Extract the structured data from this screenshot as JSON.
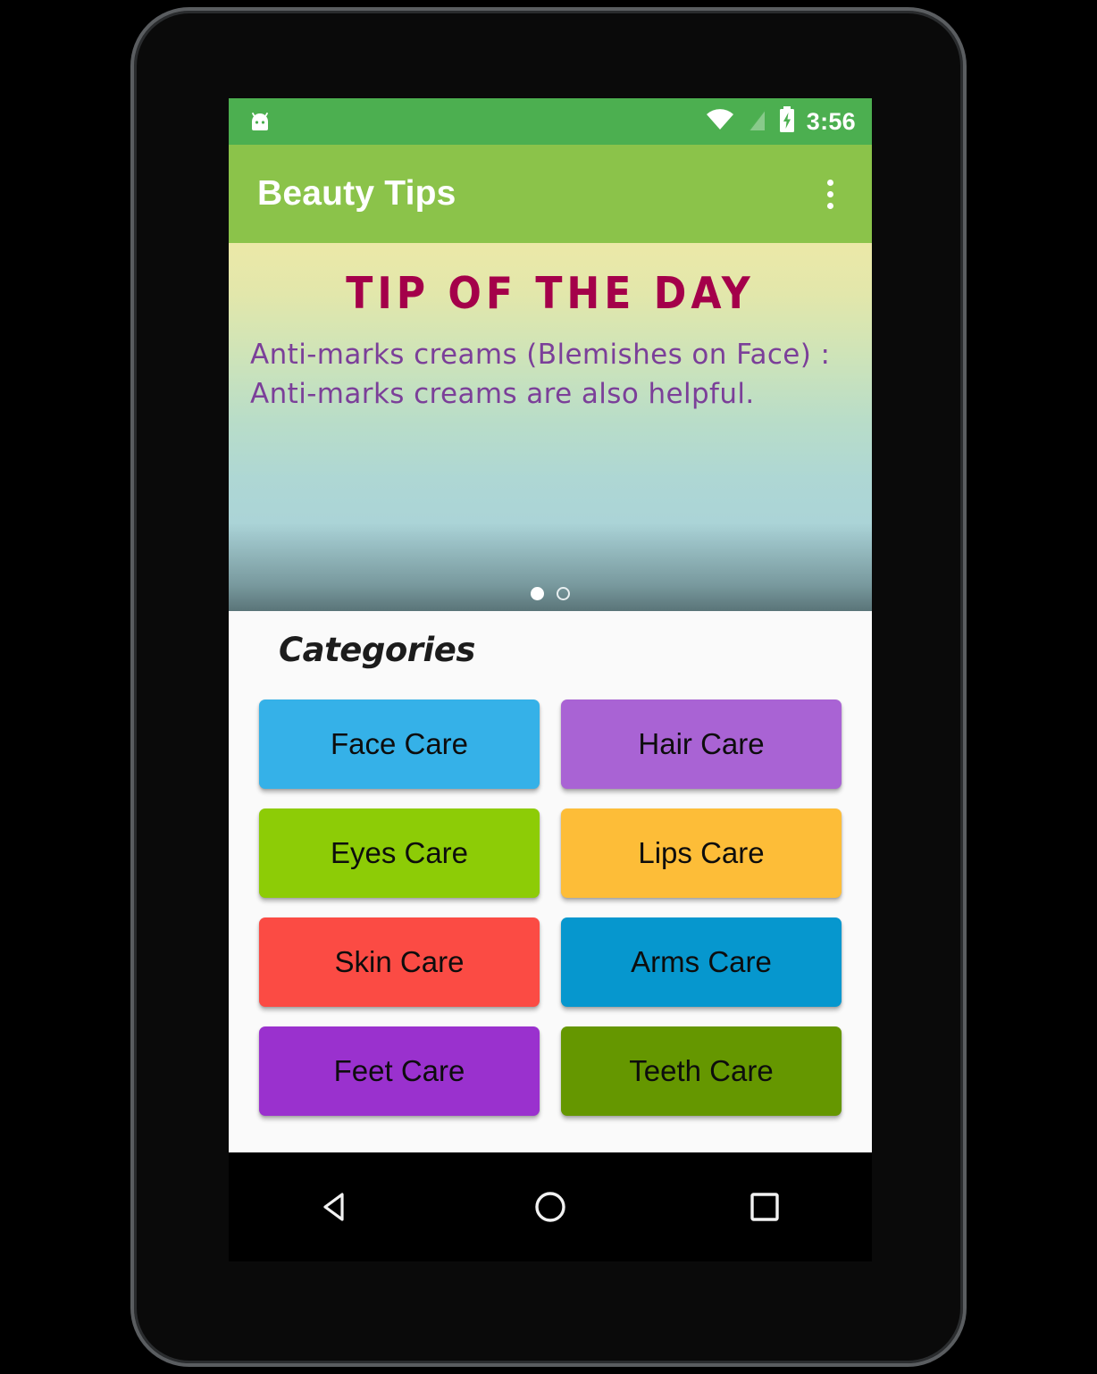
{
  "status_bar": {
    "time": "3:56",
    "icons": [
      "android-head-icon",
      "wifi-icon",
      "no-sim-icon",
      "battery-charging-icon"
    ],
    "background_color": "#4CAF50"
  },
  "app_bar": {
    "title": "Beauty Tips",
    "overflow_label": "overflow-menu",
    "background_color": "#8BC34A",
    "title_color": "#FFFFFF"
  },
  "tip_card": {
    "title": "Tip of the day",
    "text": "Anti-marks creams (Blemishes on Face) : Anti-marks creams are also helpful.",
    "title_color": "#A4004A",
    "text_color": "#7B3F99",
    "gradient_top": "#ECE8A8",
    "gradient_bottom": "#A9D1D8",
    "dots": [
      {
        "state": "active"
      },
      {
        "state": "inactive"
      }
    ]
  },
  "categories": {
    "heading": "Categories",
    "items": [
      {
        "label": "Face Care",
        "color": "#35B1E8"
      },
      {
        "label": "Hair Care",
        "color": "#A963D4"
      },
      {
        "label": "Eyes Care",
        "color": "#8DCC06"
      },
      {
        "label": "Lips Care",
        "color": "#FDBD38"
      },
      {
        "label": "Skin Care",
        "color": "#FB4B44"
      },
      {
        "label": "Arms Care",
        "color": "#0697CE"
      },
      {
        "label": "Feet Care",
        "color": "#9A31CE"
      },
      {
        "label": "Teeth Care",
        "color": "#659700"
      }
    ]
  },
  "nav_bar": {
    "buttons": [
      {
        "name": "back-icon"
      },
      {
        "name": "home-icon"
      },
      {
        "name": "recents-icon"
      }
    ],
    "background_color": "#000000"
  }
}
